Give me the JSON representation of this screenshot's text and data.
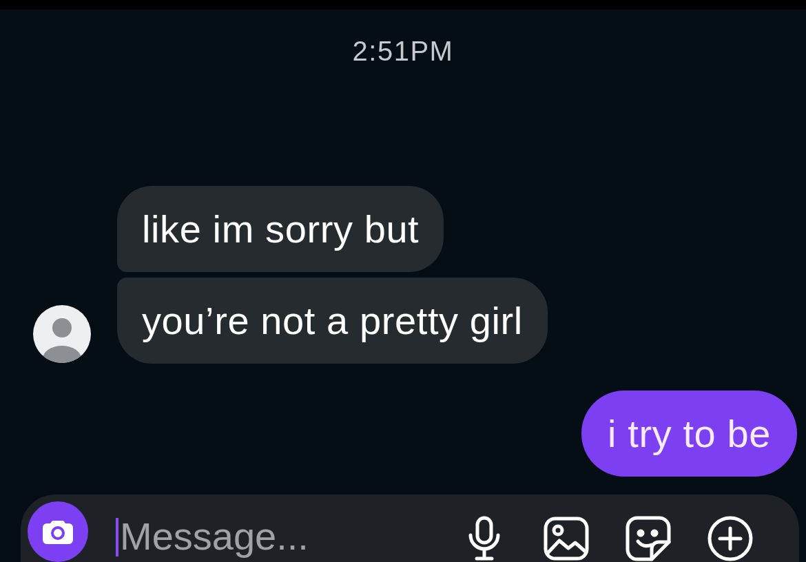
{
  "timestamp": "2:51PM",
  "messages": [
    {
      "kind": "received",
      "text": "like im sorry but",
      "avatar": false
    },
    {
      "kind": "received",
      "text": "you’re not a pretty girl",
      "avatar": true
    },
    {
      "kind": "sent",
      "text": "i try to be"
    }
  ],
  "composer": {
    "placeholder": "Message..."
  }
}
